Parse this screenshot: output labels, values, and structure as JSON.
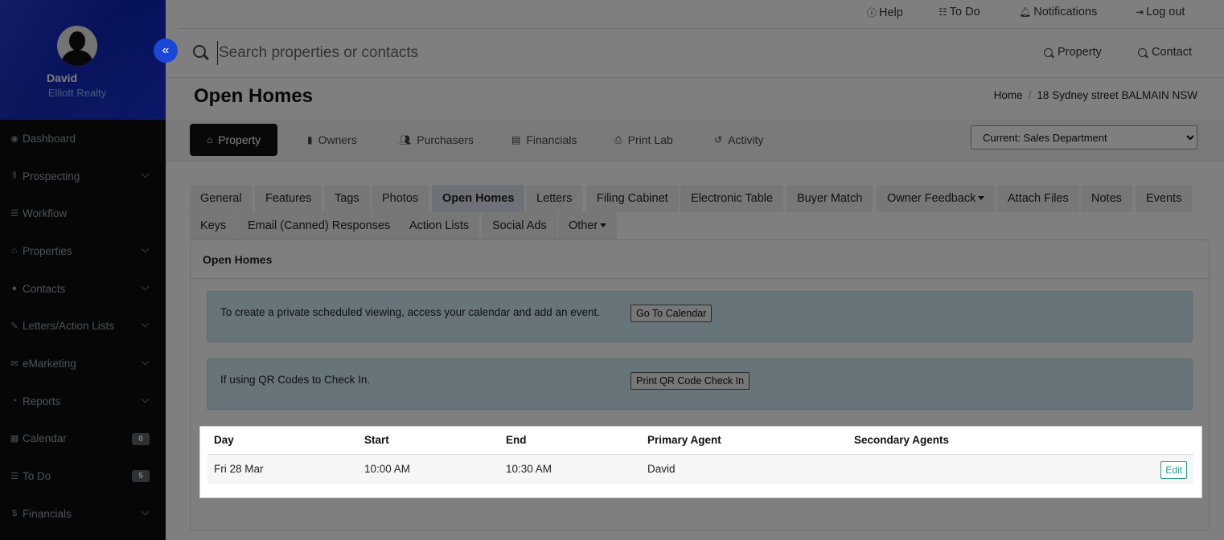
{
  "user": {
    "name": "David",
    "agency": "Elliott Realty"
  },
  "sidebar": {
    "items": [
      {
        "label": "Dashboard",
        "icon": "dashboard-icon",
        "glyph": "◉",
        "chevron": false
      },
      {
        "label": "Prospecting",
        "icon": "prospecting-icon",
        "glyph": "⦀",
        "chevron": true
      },
      {
        "label": "Workflow",
        "icon": "workflow-icon",
        "glyph": "☰",
        "chevron": false
      },
      {
        "label": "Properties",
        "icon": "home-icon",
        "glyph": "⌂",
        "chevron": true
      },
      {
        "label": "Contacts",
        "icon": "user-icon",
        "glyph": "●",
        "chevron": true
      },
      {
        "label": "Letters/Action Lists",
        "icon": "edit-icon",
        "glyph": "✎",
        "chevron": true
      },
      {
        "label": "eMarketing",
        "icon": "envelope-icon",
        "glyph": "✉",
        "chevron": true
      },
      {
        "label": "Reports",
        "icon": "pie-chart-icon",
        "glyph": "◔",
        "chevron": true
      },
      {
        "label": "Calendar",
        "icon": "calendar-icon",
        "glyph": "▦",
        "badge": "0"
      },
      {
        "label": "To Do",
        "icon": "list-icon",
        "glyph": "☰",
        "badge": "5"
      },
      {
        "label": "Financials",
        "icon": "dollar-icon",
        "glyph": "$",
        "chevron": true
      }
    ]
  },
  "topbar": {
    "help": "Help",
    "todo": "To Do",
    "notifications": "Notifications",
    "logout": "Log out"
  },
  "search": {
    "placeholder": "Search properties or contacts",
    "property": "Property",
    "contact": "Contact"
  },
  "page": {
    "title": "Open Homes"
  },
  "breadcrumb": {
    "home": "Home",
    "current": "18 Sydney street BALMAIN NSW"
  },
  "main_tabs": {
    "property": "Property",
    "owners": "Owners",
    "purchasers": "Purchasers",
    "financials": "Financials",
    "print_lab": "Print Lab",
    "activity": "Activity"
  },
  "department": {
    "selected": "Current: Sales Department"
  },
  "sub_tabs": {
    "general": "General",
    "features": "Features",
    "tags": "Tags",
    "photos": "Photos",
    "open_homes": "Open Homes",
    "letters": "Letters",
    "filing_cabinet": "Filing Cabinet",
    "electronic_table": "Electronic Table",
    "buyer_match": "Buyer Match",
    "owner_feedback": "Owner Feedback",
    "attach_files": "Attach Files",
    "notes": "Notes",
    "events": "Events",
    "keys": "Keys",
    "email_responses": "Email (Canned) Responses",
    "action_lists": "Action Lists",
    "social_ads": "Social Ads",
    "other": "Other"
  },
  "panel": {
    "title": "Open Homes",
    "calendar_info": "To create a private scheduled viewing, access your calendar and add an event.",
    "calendar_button": "Go To Calendar",
    "qr_info": "If using QR Codes to Check In.",
    "qr_button": "Print QR Code Check In"
  },
  "table": {
    "headers": {
      "day": "Day",
      "start": "Start",
      "end": "End",
      "primary": "Primary Agent",
      "secondary": "Secondary Agents"
    },
    "rows": [
      {
        "day": "Fri 28 Mar",
        "start": "10:00 AM",
        "end": "10:30 AM",
        "primary": "David",
        "secondary": "",
        "edit": "Edit"
      }
    ]
  }
}
